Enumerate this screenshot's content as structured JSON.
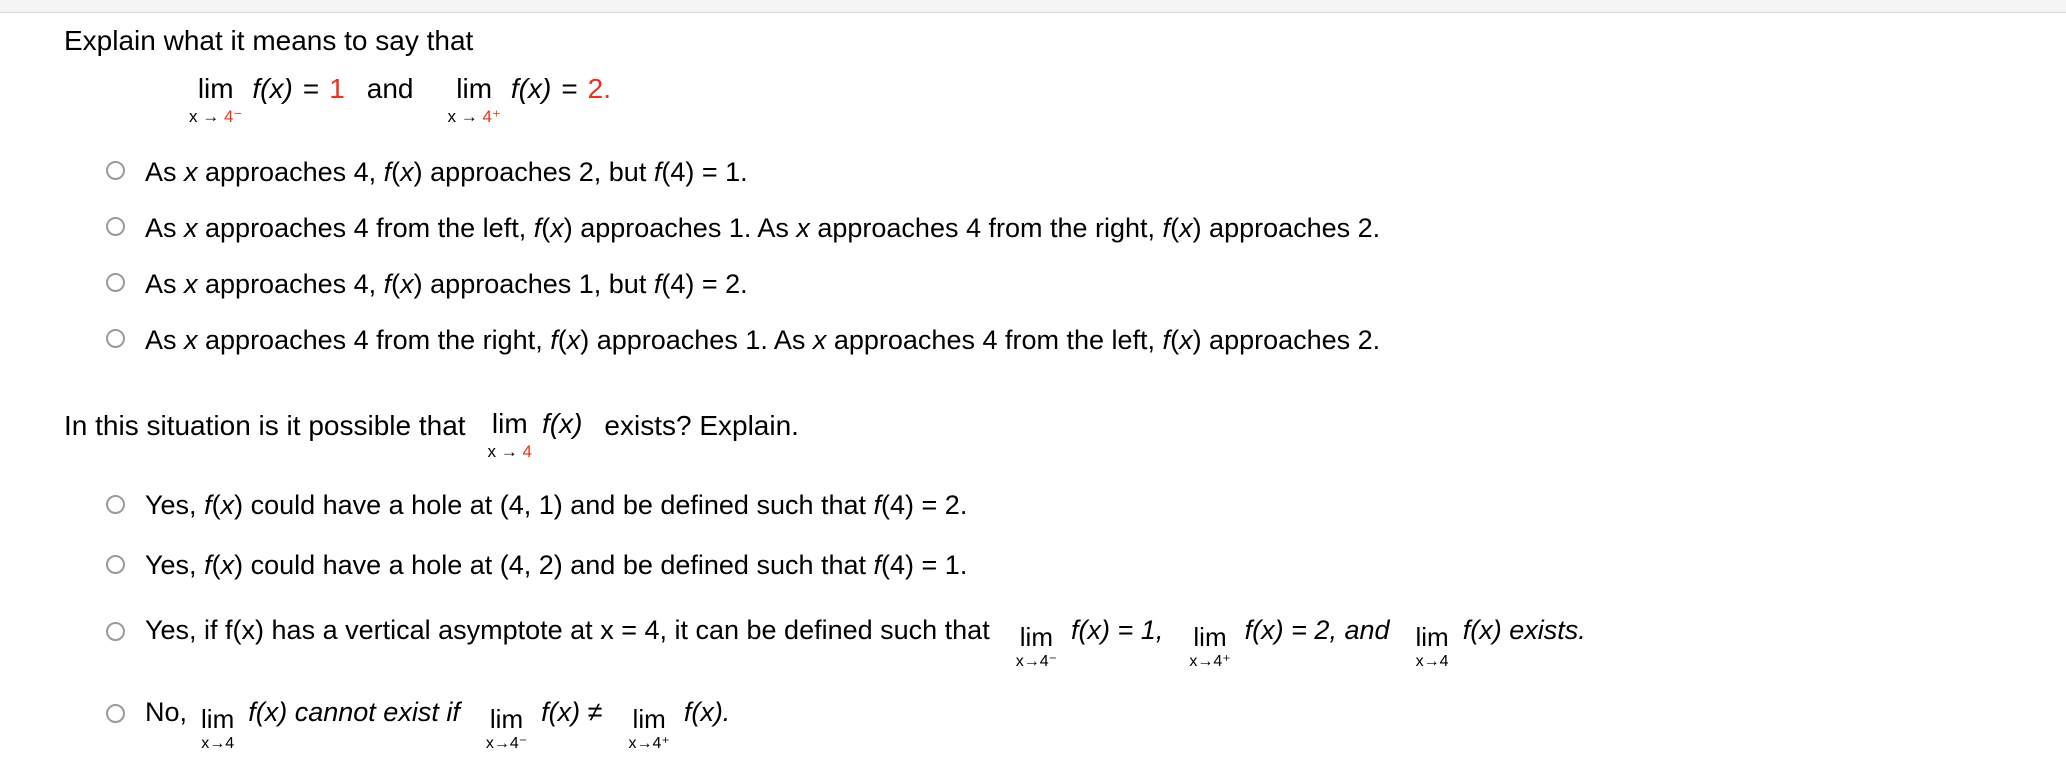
{
  "question1": {
    "prompt": "Explain what it means to say that",
    "equation": {
      "left": {
        "op": "lim",
        "sub_prefix": "x → ",
        "sub_value": "4⁻",
        "func": "f(x)",
        "equals": "=",
        "value": "1"
      },
      "conjunction": "and",
      "right": {
        "op": "lim",
        "sub_prefix": "x → ",
        "sub_value": "4⁺",
        "func": "f(x)",
        "equals": "=",
        "value": "2."
      },
      "value_color": "#e8341c"
    },
    "options": [
      {
        "id": "q1-opt1",
        "text": "As x approaches 4, f(x) approaches 2, but f(4) = 1."
      },
      {
        "id": "q1-opt2",
        "text": "As x approaches 4 from the left, f(x) approaches 1. As x approaches 4 from the right, f(x) approaches 2."
      },
      {
        "id": "q1-opt3",
        "text": "As x approaches 4, f(x) approaches 1, but f(4) = 2."
      },
      {
        "id": "q1-opt4",
        "text": "As x approaches 4 from the right, f(x) approaches 1. As x approaches 4 from the left, f(x) approaches 2."
      }
    ]
  },
  "question2": {
    "prompt_before": "In this situation is it possible that",
    "limit": {
      "op": "lim",
      "sub_prefix": "x → ",
      "sub_value": "4",
      "func": "f(x)"
    },
    "prompt_after": "exists? Explain.",
    "options": [
      {
        "id": "q2-opt1",
        "kind": "plain",
        "text": "Yes, f(x) could have a hole at (4, 1) and be defined such that f(4) = 2."
      },
      {
        "id": "q2-opt2",
        "kind": "plain",
        "text": "Yes, f(x) could have a hole at (4, 2) and be defined such that f(4) = 1."
      },
      {
        "id": "q2-opt3",
        "kind": "math",
        "seg1": "Yes, if f(x) has a vertical asymptote at x = 4, it can be defined such that",
        "lim1": {
          "op": "lim",
          "sub": "x→4⁻"
        },
        "seg2": "f(x) = 1,",
        "lim2": {
          "op": "lim",
          "sub": "x→4⁺"
        },
        "seg3": "f(x) = 2, and",
        "lim3": {
          "op": "lim",
          "sub": "x→4"
        },
        "seg4": "f(x) exists."
      },
      {
        "id": "q2-opt4",
        "kind": "math",
        "seg1": "No,",
        "lim1": {
          "op": "lim",
          "sub": "x→4"
        },
        "seg2": "f(x) cannot exist if",
        "lim2": {
          "op": "lim",
          "sub": "x→4⁻"
        },
        "seg3": "f(x) ≠",
        "lim3": {
          "op": "lim",
          "sub": "x→4⁺"
        },
        "seg4": "f(x)."
      }
    ]
  }
}
